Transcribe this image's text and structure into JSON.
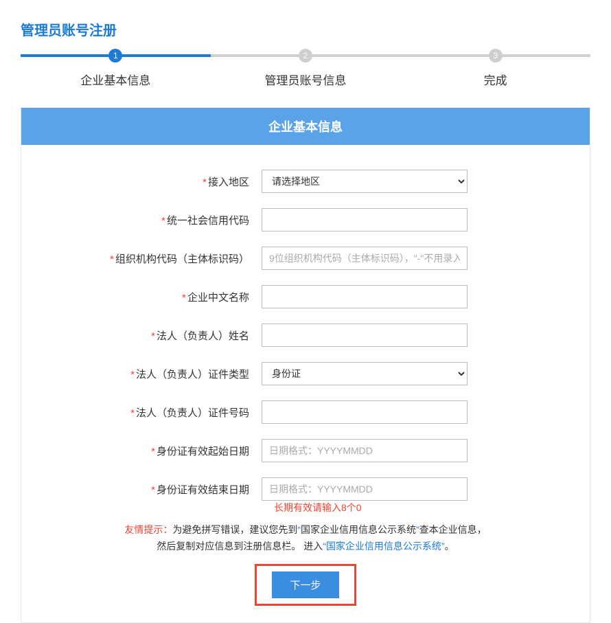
{
  "page_title": "管理员账号注册",
  "steps": [
    {
      "num": "1",
      "label": "企业基本信息"
    },
    {
      "num": "2",
      "label": "管理员账号信息"
    },
    {
      "num": "3",
      "label": "完成"
    }
  ],
  "panel_header": "企业基本信息",
  "form": {
    "region": {
      "label": "接入地区",
      "selected": "请选择地区"
    },
    "uscc": {
      "label": "统一社会信用代码",
      "value": ""
    },
    "org_code": {
      "label": "组织机构代码（主体标识码）",
      "placeholder": "9位组织机构代码（主体标识码），\"-\"不用录入",
      "value": ""
    },
    "cn_name": {
      "label": "企业中文名称",
      "value": ""
    },
    "legal_name": {
      "label": "法人（负责人）姓名",
      "value": ""
    },
    "id_type": {
      "label": "法人（负责人）证件类型",
      "selected": "身份证"
    },
    "id_number": {
      "label": "法人（负责人）证件号码",
      "value": ""
    },
    "id_start": {
      "label": "身份证有效起始日期",
      "placeholder": "日期格式：YYYYMMDD",
      "value": ""
    },
    "id_end": {
      "label": "身份证有效结束日期",
      "placeholder": "日期格式：YYYYMMDD",
      "value": ""
    }
  },
  "end_note": "长期有效请输入8个0",
  "tip": {
    "label": "友情提示：",
    "line1_a": "为避免拼写错误，建议您先到",
    "q1_open": "“",
    "sys1": "国家企业信用信息公示系统",
    "q1_close": "”",
    "line1_b": "查本企业信息，",
    "line2_a": "然后复制对应信息到注册信息栏。 进入",
    "q2_open": "“",
    "link": "国家企业信用信息公示系统",
    "q2_close": "”",
    "line2_b": "。"
  },
  "submit_label": "下一步"
}
